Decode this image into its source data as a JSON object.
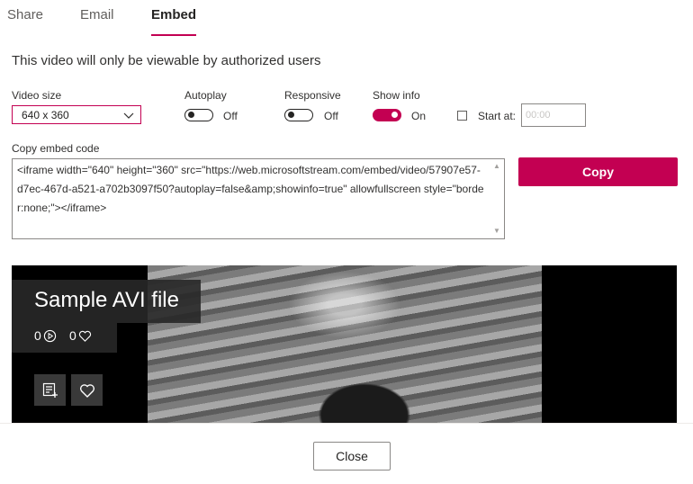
{
  "tabs": [
    "Share",
    "Email",
    "Embed"
  ],
  "active_tab": "Embed",
  "notice": "This video will only be viewable by authorized users",
  "video_size": {
    "label": "Video size",
    "value": "640 x 360"
  },
  "autoplay": {
    "label": "Autoplay",
    "state": "Off"
  },
  "responsive": {
    "label": "Responsive",
    "state": "Off"
  },
  "show_info": {
    "label": "Show info",
    "state": "On"
  },
  "start_at": {
    "label": "Start at:",
    "placeholder": "00:00",
    "checked": false
  },
  "embed": {
    "label": "Copy embed code",
    "code": "<iframe width=\"640\" height=\"360\" src=\"https://web.microsoftstream.com/embed/video/57907e57-d7ec-467d-a521-a702b3097f50?autoplay=false&amp;showinfo=true\" allowfullscreen style=\"border:none;\"></iframe>"
  },
  "copy_button": "Copy",
  "player": {
    "title": "Sample AVI file",
    "views": "0",
    "likes": "0"
  },
  "close_button": "Close",
  "colors": {
    "accent": "#c30052",
    "text": "#252423",
    "player_bg": "#000000"
  },
  "icons": [
    "chevron-down-icon",
    "play-circle-icon",
    "heart-icon",
    "add-to-playlist-icon",
    "heart-icon"
  ]
}
